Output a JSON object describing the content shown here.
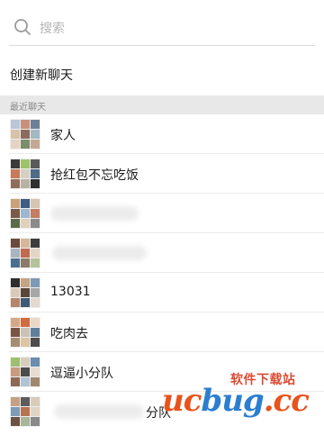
{
  "search": {
    "placeholder": "搜索"
  },
  "create_chat": {
    "label": "创建新聊天"
  },
  "section": {
    "recent_label": "最近聊天"
  },
  "chats": [
    {
      "name": "家人",
      "blurred": false
    },
    {
      "name": "抢红包不忘吃饭",
      "blurred": false
    },
    {
      "name": "",
      "blurred": true
    },
    {
      "name": "",
      "blurred": true
    },
    {
      "name": "13031",
      "blurred": false
    },
    {
      "name": "吃肉去",
      "blurred": false
    },
    {
      "name": "逗逼小分队",
      "blurred": false
    },
    {
      "name": "分队",
      "blurred": true
    }
  ],
  "watermark": {
    "top": "软件下载站",
    "logo_a": "uc",
    "logo_b": "bug",
    "logo_c": ".cc"
  },
  "colors": {
    "accent": "#e8521c",
    "separator": "#ececec",
    "section_bg": "#e8e8e8"
  }
}
